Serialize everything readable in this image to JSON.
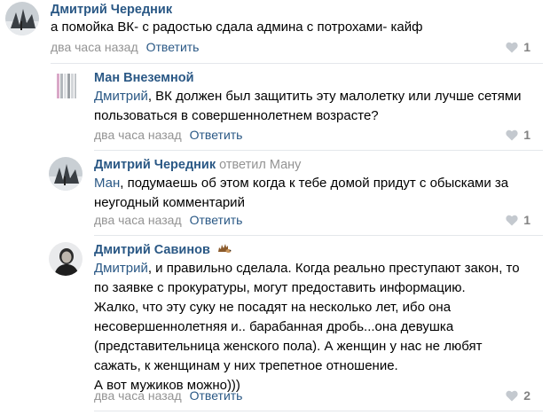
{
  "colors": {
    "link": "#2a5885",
    "muted": "#939393",
    "divider": "#e4e7eb"
  },
  "comments": [
    {
      "author": "Дмитрий Чередник",
      "text_lines": [
        "а помойка ВК- с радостью сдала админа с потрохами- кайф"
      ],
      "time": "два часа назад",
      "reply_label": "Ответить",
      "likes": "1",
      "like_icon": "heart-icon"
    },
    {
      "author": "Ман Внеземной",
      "mention": "Дмитрий",
      "text_first": ", ВК должен был защитить эту малолетку или лучше сетями",
      "text_lines": [
        "пользоваться в совершеннолетнем возрасте?"
      ],
      "time": "два часа назад",
      "reply_label": "Ответить",
      "likes": "1",
      "like_icon": "heart-icon"
    },
    {
      "author": "Дмитрий Чередник",
      "replied_to": "ответил Ману",
      "mention": "Ман",
      "text_first": ", подумаешь об этом когда к тебе домой придут с обысками за",
      "text_lines": [
        "неугодный комментарий"
      ],
      "time": "два часа назад",
      "reply_label": "Ответить",
      "likes": "1",
      "like_icon": "heart-icon"
    },
    {
      "author": "Дмитрий Савинов",
      "author_badge_icon": "hedgehog-icon",
      "mention": "Дмитрий",
      "text_first": ", и правильно сделала. Когда реально преступают закон, то",
      "text_lines": [
        "по заявке с прокуратуры, могут предоставить информацию.",
        "Жалко, что эту суку не посадят на несколько лет, ибо она",
        "несовершеннолетняя и.. барабанная дробь...она девушка",
        "(представительница женского пола). А женщин у нас не любят",
        "сажать, к женщинам у них трепетное отношение.",
        "А вот мужиков можно)))"
      ],
      "time": "два часа назад",
      "reply_label": "Ответить",
      "likes": "2",
      "like_icon": "heart-icon"
    }
  ]
}
